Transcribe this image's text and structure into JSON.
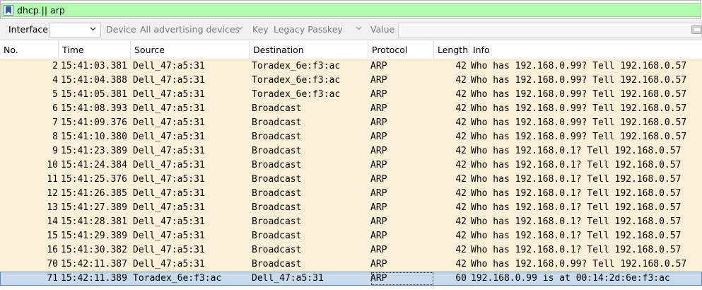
{
  "filter": {
    "text": "dhcp || arp"
  },
  "toolbar": {
    "interface_label": "Interface",
    "interface_value": "",
    "device_label": "Device",
    "device_value": "All advertising devices",
    "key_label": "Key",
    "key_value": "Legacy Passkey",
    "value_label": "Value",
    "value_value": ""
  },
  "columns": {
    "no": "No.",
    "time": "Time",
    "source": "Source",
    "destination": "Destination",
    "protocol": "Protocol",
    "length": "Length",
    "info": "Info"
  },
  "packets": [
    {
      "no": "2",
      "time": "15:41:03.381",
      "source": "Dell_47:a5:31",
      "destination": "Toradex_6e:f3:ac",
      "protocol": "ARP",
      "length": "42",
      "info": "Who has 192.168.0.99? Tell 192.168.0.57"
    },
    {
      "no": "4",
      "time": "15:41:04.388",
      "source": "Dell_47:a5:31",
      "destination": "Toradex_6e:f3:ac",
      "protocol": "ARP",
      "length": "42",
      "info": "Who has 192.168.0.99? Tell 192.168.0.57"
    },
    {
      "no": "5",
      "time": "15:41:05.381",
      "source": "Dell_47:a5:31",
      "destination": "Toradex_6e:f3:ac",
      "protocol": "ARP",
      "length": "42",
      "info": "Who has 192.168.0.99? Tell 192.168.0.57"
    },
    {
      "no": "6",
      "time": "15:41:08.393",
      "source": "Dell_47:a5:31",
      "destination": "Broadcast",
      "protocol": "ARP",
      "length": "42",
      "info": "Who has 192.168.0.99? Tell 192.168.0.57"
    },
    {
      "no": "7",
      "time": "15:41:09.376",
      "source": "Dell_47:a5:31",
      "destination": "Broadcast",
      "protocol": "ARP",
      "length": "42",
      "info": "Who has 192.168.0.99? Tell 192.168.0.57"
    },
    {
      "no": "8",
      "time": "15:41:10.380",
      "source": "Dell_47:a5:31",
      "destination": "Broadcast",
      "protocol": "ARP",
      "length": "42",
      "info": "Who has 192.168.0.99? Tell 192.168.0.57"
    },
    {
      "no": "9",
      "time": "15:41:23.389",
      "source": "Dell_47:a5:31",
      "destination": "Broadcast",
      "protocol": "ARP",
      "length": "42",
      "info": "Who has 192.168.0.1? Tell 192.168.0.57"
    },
    {
      "no": "10",
      "time": "15:41:24.384",
      "source": "Dell_47:a5:31",
      "destination": "Broadcast",
      "protocol": "ARP",
      "length": "42",
      "info": "Who has 192.168.0.1? Tell 192.168.0.57"
    },
    {
      "no": "11",
      "time": "15:41:25.376",
      "source": "Dell_47:a5:31",
      "destination": "Broadcast",
      "protocol": "ARP",
      "length": "42",
      "info": "Who has 192.168.0.1? Tell 192.168.0.57"
    },
    {
      "no": "12",
      "time": "15:41:26.385",
      "source": "Dell_47:a5:31",
      "destination": "Broadcast",
      "protocol": "ARP",
      "length": "42",
      "info": "Who has 192.168.0.1? Tell 192.168.0.57"
    },
    {
      "no": "13",
      "time": "15:41:27.389",
      "source": "Dell_47:a5:31",
      "destination": "Broadcast",
      "protocol": "ARP",
      "length": "42",
      "info": "Who has 192.168.0.1? Tell 192.168.0.57"
    },
    {
      "no": "14",
      "time": "15:41:28.381",
      "source": "Dell_47:a5:31",
      "destination": "Broadcast",
      "protocol": "ARP",
      "length": "42",
      "info": "Who has 192.168.0.1? Tell 192.168.0.57"
    },
    {
      "no": "15",
      "time": "15:41:29.389",
      "source": "Dell_47:a5:31",
      "destination": "Broadcast",
      "protocol": "ARP",
      "length": "42",
      "info": "Who has 192.168.0.1? Tell 192.168.0.57"
    },
    {
      "no": "16",
      "time": "15:41:30.382",
      "source": "Dell_47:a5:31",
      "destination": "Broadcast",
      "protocol": "ARP",
      "length": "42",
      "info": "Who has 192.168.0.1? Tell 192.168.0.57"
    },
    {
      "no": "70",
      "time": "15:42:11.387",
      "source": "Dell_47:a5:31",
      "destination": "Broadcast",
      "protocol": "ARP",
      "length": "42",
      "info": "Who has 192.168.0.99? Tell 192.168.0.57"
    },
    {
      "no": "71",
      "time": "15:42:11.389",
      "source": "Toradex_6e:f3:ac",
      "destination": "Dell_47:a5:31",
      "protocol": "ARP",
      "length": "60",
      "info": "192.168.0.99 is at 00:14:2d:6e:f3:ac",
      "selected": true
    }
  ],
  "colors": {
    "filter_valid_bg": "#afffaf",
    "arp_row_bg": "#faf0d7",
    "selected_row_bg": "#c9dbea"
  },
  "icons": {
    "bookmark": "bookmark-icon",
    "dropdown": "chevron-down-icon"
  }
}
